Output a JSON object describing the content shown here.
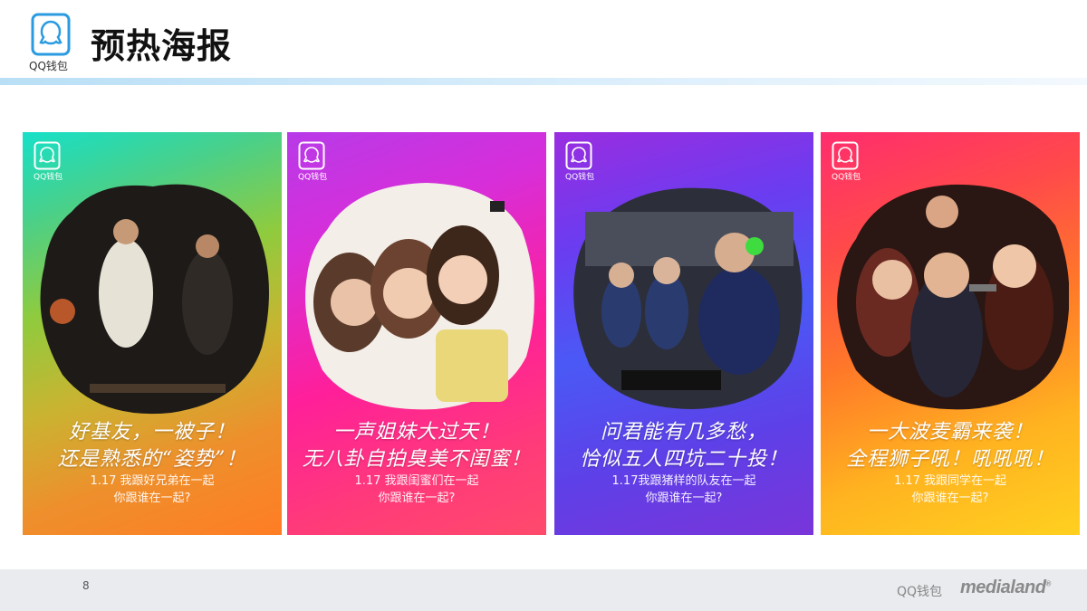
{
  "header": {
    "logo_label": "QQ钱包",
    "title": "预热海报"
  },
  "posters": [
    {
      "logo_label": "QQ钱包",
      "slogan_line1": "好基友，一被子！",
      "slogan_line2": "还是熟悉的“姿势”！",
      "sub_line1": "1.17 我跟好兄弟在一起",
      "sub_line2": "你跟谁在一起?",
      "photo_icon": "basketball-players-photo"
    },
    {
      "logo_label": "QQ钱包",
      "slogan_line1": "一声姐妹大过天！",
      "slogan_line2": "无八卦自拍臭美不闺蜜！",
      "sub_line1": "1.17 我跟闺蜜们在一起",
      "sub_line2": "你跟谁在一起?",
      "photo_icon": "girls-selfie-photo"
    },
    {
      "logo_label": "QQ钱包",
      "slogan_line1": "问君能有几多愁，",
      "slogan_line2": "恰似五人四坑二十投！",
      "sub_line1": "1.17我跟猪样的队友在一起",
      "sub_line2": "你跟谁在一起?",
      "photo_icon": "gamers-photo"
    },
    {
      "logo_label": "QQ钱包",
      "slogan_line1": "一大波麦霸来袭！",
      "slogan_line2": "全程狮子吼！吼吼吼！",
      "sub_line1": "1.17 我跟同学在一起",
      "sub_line2": "你跟谁在一起?",
      "photo_icon": "karaoke-friends-photo"
    }
  ],
  "footer": {
    "page_number": "8",
    "brand": "QQ钱包",
    "partner": "medialand"
  },
  "colors": {
    "accent_rule": "#b9dff6",
    "logo_blue": "#2a9be0",
    "footer_bg": "#e9ebee"
  }
}
